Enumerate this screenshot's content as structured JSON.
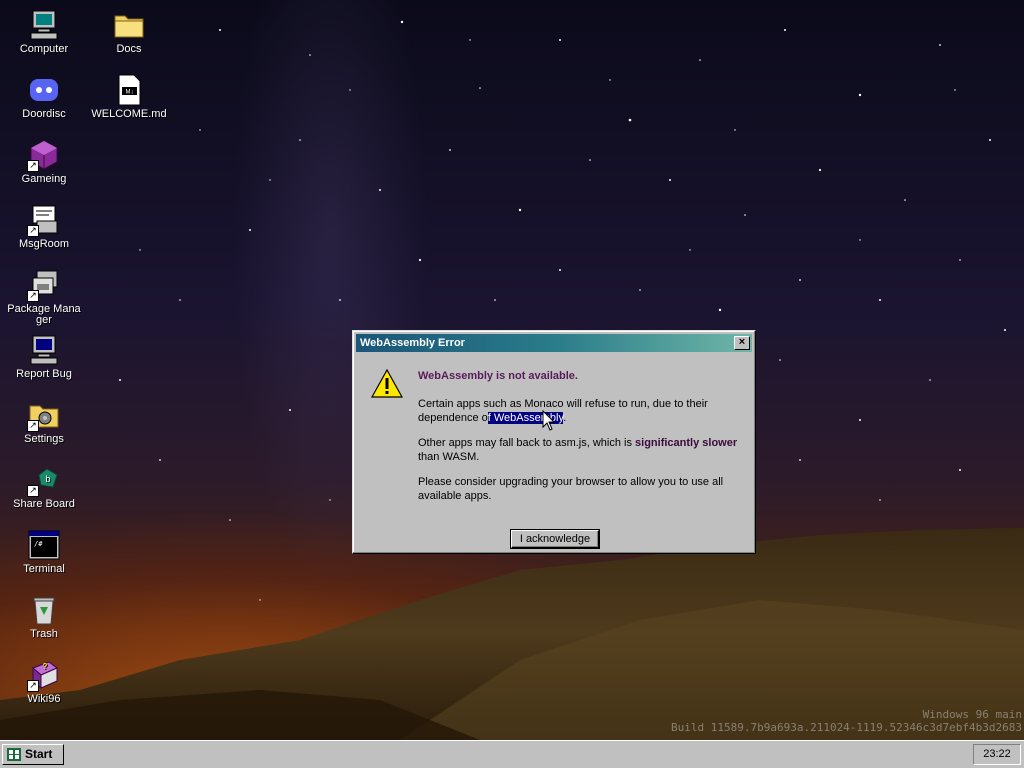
{
  "desktop": {
    "icons": [
      {
        "label": "Computer"
      },
      {
        "label": "Docs"
      },
      {
        "label": "Doordisc"
      },
      {
        "label": "WELCOME.md"
      },
      {
        "label": "Gameing"
      },
      {
        "label": "MsgRoom"
      },
      {
        "label": "Package Manager"
      },
      {
        "label": "Report Bug"
      },
      {
        "label": "Settings"
      },
      {
        "label": "Share Board"
      },
      {
        "label": "Terminal"
      },
      {
        "label": "Trash"
      },
      {
        "label": "Wiki96"
      }
    ],
    "watermark": {
      "line1": "Windows 96 main",
      "line2": "Build 11589.7b9a693a.211024-1119.52346c3d7ebf4b3d2683"
    }
  },
  "dialog": {
    "title": "WebAssembly Error",
    "close_label": "×",
    "heading": "WebAssembly is not available.",
    "para1_pre": "Certain apps such as Monaco will refuse to run, due to their dependence o",
    "para1_selected": "f WebAssembly",
    "para1_post": ".",
    "para2_pre": "Other apps may fall back to asm.js, which is ",
    "para2_bold1": "significantly slower",
    "para2_post": " than WASM.",
    "para3": "Please consider upgrading your browser to allow you to use all available apps.",
    "button_label": "I acknowledge"
  },
  "taskbar": {
    "start_label": "Start",
    "clock": "23:22"
  },
  "colors": {
    "titlebar_start": "#1a5578",
    "titlebar_end": "#6fb6a8",
    "selection": "#000080",
    "window": "#c0c0c0"
  }
}
